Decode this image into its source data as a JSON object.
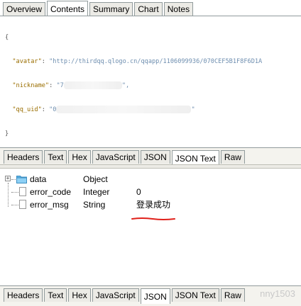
{
  "top_tabs": [
    {
      "label": "Overview",
      "active": false
    },
    {
      "label": "Contents",
      "active": true
    },
    {
      "label": "Summary",
      "active": false
    },
    {
      "label": "Chart",
      "active": false
    },
    {
      "label": "Notes",
      "active": false
    }
  ],
  "json_text": {
    "open_brace": "{",
    "close_brace": "}",
    "avatar_key": "\"avatar\"",
    "avatar_value": "\"http://thirdqq.qlogo.cn/qqapp/1106099936/070CEF5B1F8F6D1A",
    "nickname_key": "\"nickname\"",
    "nickname_value_start": "\"7",
    "nickname_value_end": "\",",
    "uid_key": "\"qq_uid\"",
    "uid_value_start": "\"0",
    "uid_value_end": "\""
  },
  "middle_tabs": [
    {
      "label": "Headers",
      "active": false
    },
    {
      "label": "Text",
      "active": false
    },
    {
      "label": "Hex",
      "active": false
    },
    {
      "label": "JavaScript",
      "active": false
    },
    {
      "label": "JSON",
      "active": false
    },
    {
      "label": "JSON Text",
      "active": true
    },
    {
      "label": "Raw",
      "active": false
    }
  ],
  "tree": [
    {
      "name": "data",
      "type": "Object",
      "value": "",
      "kind": "folder"
    },
    {
      "name": "error_code",
      "type": "Integer",
      "value": "0",
      "kind": "item"
    },
    {
      "name": "error_msg",
      "type": "String",
      "value": "登录成功",
      "kind": "item"
    }
  ],
  "bottom_tabs": [
    {
      "label": "Headers",
      "active": false
    },
    {
      "label": "Text",
      "active": false
    },
    {
      "label": "Hex",
      "active": false
    },
    {
      "label": "JavaScript",
      "active": false
    },
    {
      "label": "JSON",
      "active": true
    },
    {
      "label": "JSON Text",
      "active": false
    },
    {
      "label": "Raw",
      "active": false
    }
  ],
  "watermark": "nny1503",
  "colors": {
    "annotation_red": "#e0201a",
    "folder_blue": "#5fb6e8"
  }
}
